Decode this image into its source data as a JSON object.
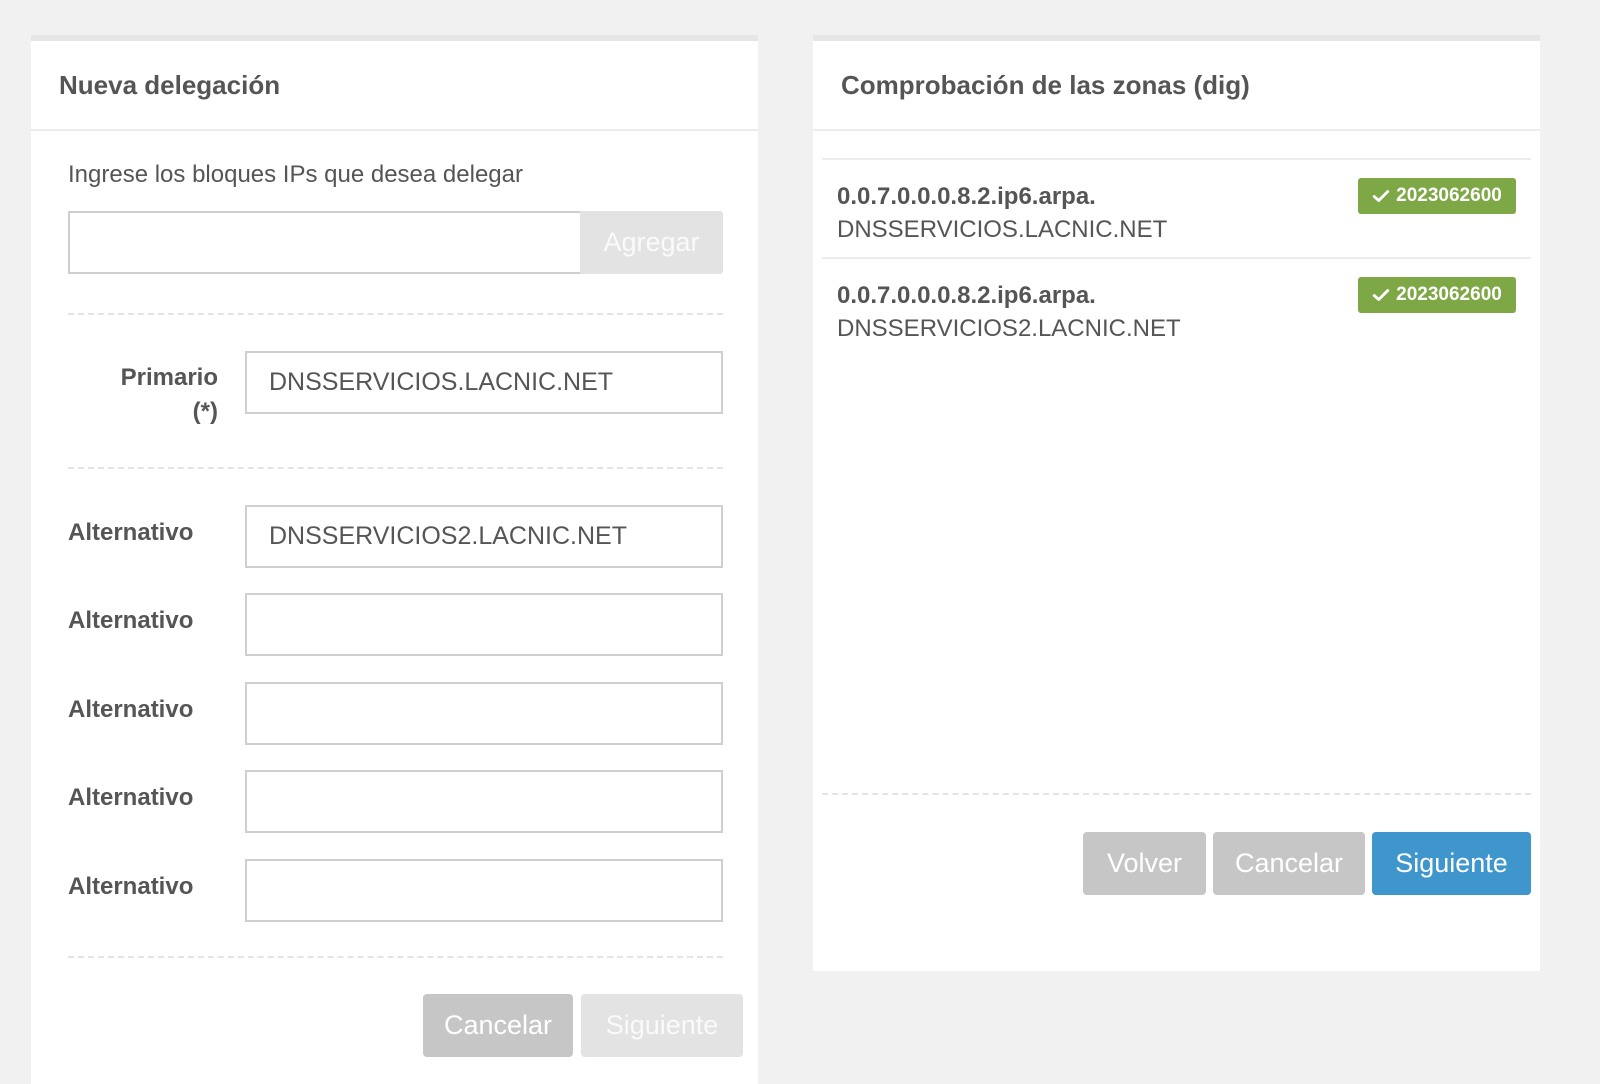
{
  "left_panel": {
    "title": "Nueva delegación",
    "intro": "Ingrese los bloques IPs que desea delegar",
    "add_input_value": "",
    "add_button": "Agregar",
    "primary_label_line1": "Primario",
    "primary_label_line2": "(*)",
    "primary_value": "DNSSERVICIOS.LACNIC.NET",
    "alternates": [
      {
        "label": "Alternativo",
        "value": "DNSSERVICIOS2.LACNIC.NET"
      },
      {
        "label": "Alternativo",
        "value": ""
      },
      {
        "label": "Alternativo",
        "value": ""
      },
      {
        "label": "Alternativo",
        "value": ""
      },
      {
        "label": "Alternativo",
        "value": ""
      }
    ],
    "cancel_button": "Cancelar",
    "next_button": "Siguiente"
  },
  "right_panel": {
    "title": "Comprobación de las zonas (dig)",
    "zones": [
      {
        "name": "0.0.7.0.0.0.8.2.ip6.arpa.",
        "server": "DNSSERVICIOS.LACNIC.NET",
        "serial": "2023062600",
        "status_icon": "check-icon"
      },
      {
        "name": "0.0.7.0.0.0.8.2.ip6.arpa.",
        "server": "DNSSERVICIOS2.LACNIC.NET",
        "serial": "2023062600",
        "status_icon": "check-icon"
      }
    ],
    "back_button": "Volver",
    "cancel_button": "Cancelar",
    "next_button": "Siguiente"
  },
  "colors": {
    "accent_blue": "#3f96cd",
    "success_green": "#7ea745",
    "background": "#f1f1f1"
  }
}
